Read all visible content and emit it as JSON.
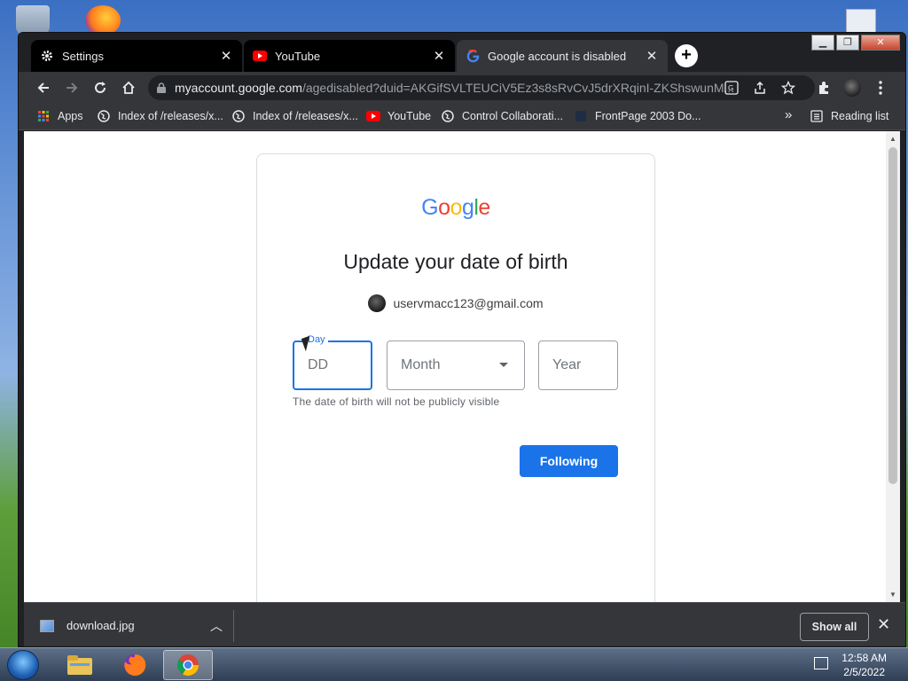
{
  "browser": {
    "tabs": [
      {
        "label": "Settings",
        "icon": "gear-icon"
      },
      {
        "label": "YouTube",
        "icon": "youtube-icon"
      },
      {
        "label": "Google account is disabled",
        "icon": "google-g-icon"
      }
    ],
    "new_tab_label": "+",
    "url": {
      "host": "myaccount.google.com",
      "path": "/agedisabled?duid=AKGifSVLTEUCiV5Ez3s8sRvCvJ5drXRqinI-ZKShswunM..."
    },
    "bookmarks": [
      {
        "label": "Apps",
        "icon": "apps-grid-icon"
      },
      {
        "label": "Index of /releases/x...",
        "icon": "globe-icon"
      },
      {
        "label": "Index of /releases/x...",
        "icon": "globe-icon"
      },
      {
        "label": "YouTube",
        "icon": "youtube-icon"
      },
      {
        "label": "Control Collaborati...",
        "icon": "globe-icon"
      },
      {
        "label": "FrontPage 2003 Do...",
        "icon": "frontpage-icon"
      }
    ],
    "bookmarks_overflow": "»",
    "reading_list": "Reading list"
  },
  "page": {
    "logo": [
      "G",
      "o",
      "o",
      "g",
      "l",
      "e"
    ],
    "logo_colors": [
      "#4285f4",
      "#ea4335",
      "#fbbc05",
      "#4285f4",
      "#34a853",
      "#ea4335"
    ],
    "heading": "Update your date of birth",
    "account_email": "uservmacc123@gmail.com",
    "day_label": "Day",
    "day_placeholder": "DD",
    "month_placeholder": "Month",
    "year_placeholder": "Year",
    "hint": "The date of birth will not be publicly visible",
    "next_button": "Following"
  },
  "downloads": {
    "file": "download.jpg",
    "show_all": "Show all"
  },
  "taskbar": {
    "time": "12:58 AM",
    "date": "2/5/2022"
  },
  "colors": {
    "accent": "#1a73e8",
    "chrome_dark": "#35363a"
  }
}
